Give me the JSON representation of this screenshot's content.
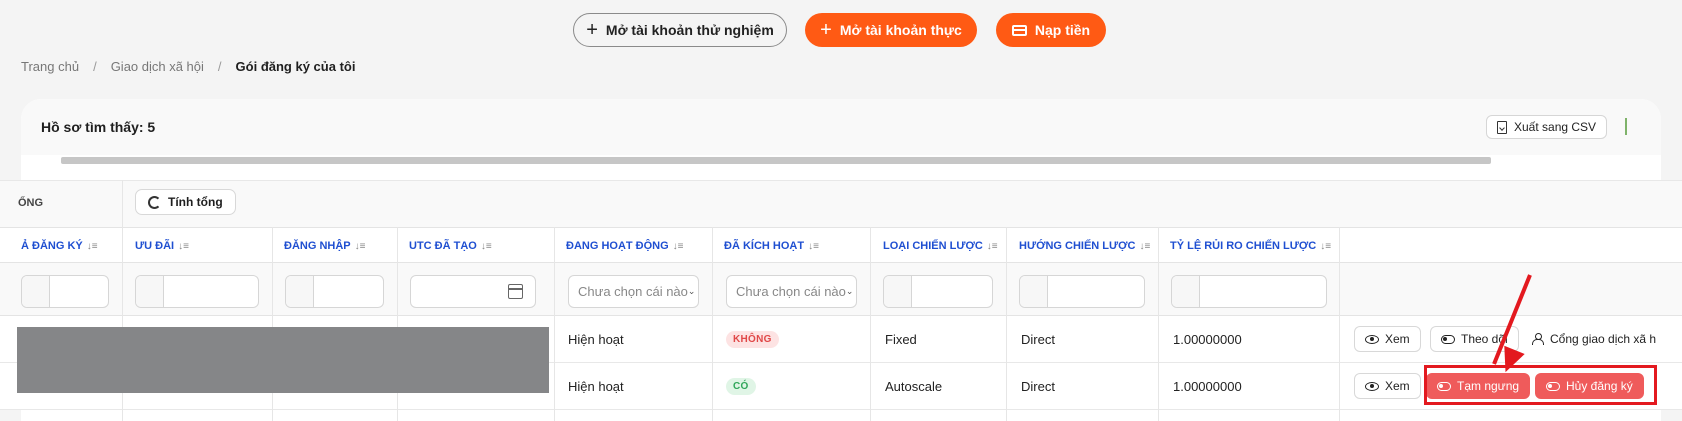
{
  "top_actions": {
    "demo_account": "Mở tài khoản thử nghiệm",
    "real_account": "Mở tài khoản thực",
    "deposit": "Nạp tiền"
  },
  "breadcrumb": {
    "home": "Trang chủ",
    "social_trading": "Giao dịch xã hội",
    "current": "Gói đăng ký của tôi",
    "separator": "/"
  },
  "panel": {
    "records_found": "Hồ sơ tìm thấy: 5",
    "export_csv": "Xuất sang CSV",
    "totals_cut_label": "ỔNG",
    "calculate_totals": "Tính tổng"
  },
  "columns": [
    "Ả ĐĂNG KÝ",
    "ƯU ĐÃI",
    "ĐĂNG NHẬP",
    "UTC ĐÃ TẠO",
    "ĐANG HOẠT ĐỘNG",
    "ĐÃ KÍCH HOẠT",
    "LOẠI CHIẾN LƯỢC",
    "HƯỚNG CHIẾN LƯỢC",
    "TỶ LỆ RỦI RO CHIẾN LƯỢC"
  ],
  "filters": {
    "active_placeholder": "Chưa chọn cái nào",
    "activated_placeholder": "Chưa chọn cái nào"
  },
  "rows": [
    {
      "active": "Hiện hoạt",
      "activated": "KHÔNG",
      "strategy_type": "Fixed",
      "strategy_direction": "Direct",
      "risk_ratio": "1.00000000",
      "actions": [
        "Xem",
        "Theo dõi",
        "Cổng giao dịch xã h"
      ]
    },
    {
      "active": "Hiện hoạt",
      "activated": "CÓ",
      "strategy_type": "Autoscale",
      "strategy_direction": "Direct",
      "risk_ratio": "1.00000000",
      "actions": [
        "Xem",
        "Tạm ngưng",
        "Hủy đăng ký"
      ]
    }
  ],
  "colors": {
    "brand_orange": "#ff5a14",
    "link_blue": "#1f4fd1",
    "annotation_red": "#e3191f",
    "action_red": "#ef5b5b"
  }
}
